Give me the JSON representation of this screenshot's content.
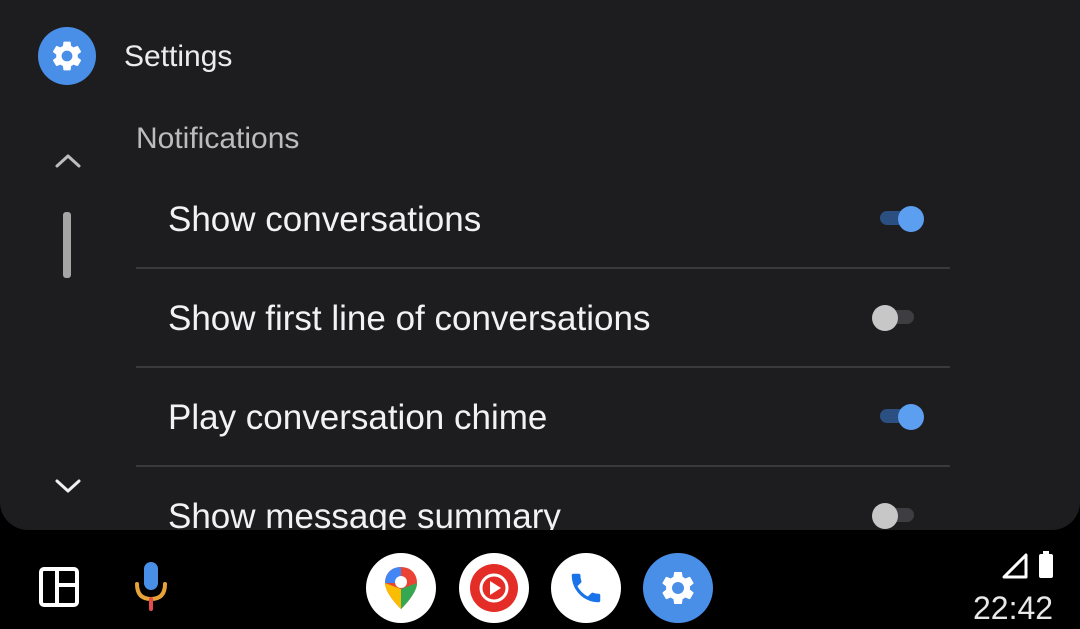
{
  "header": {
    "title": "Settings"
  },
  "section": {
    "title": "Notifications"
  },
  "settings": [
    {
      "label": "Show conversations",
      "enabled": true
    },
    {
      "label": "Show first line of conversations",
      "enabled": false
    },
    {
      "label": "Play conversation chime",
      "enabled": true
    },
    {
      "label": "Show message summary",
      "enabled": false
    }
  ],
  "taskbar": {
    "apps": [
      "maps-icon",
      "youtube-music-icon",
      "phone-icon",
      "settings-icon"
    ],
    "time": "22:42"
  },
  "colors": {
    "accent": "#5c9ef0",
    "panel": "#1d1d20",
    "background": "#000000"
  }
}
